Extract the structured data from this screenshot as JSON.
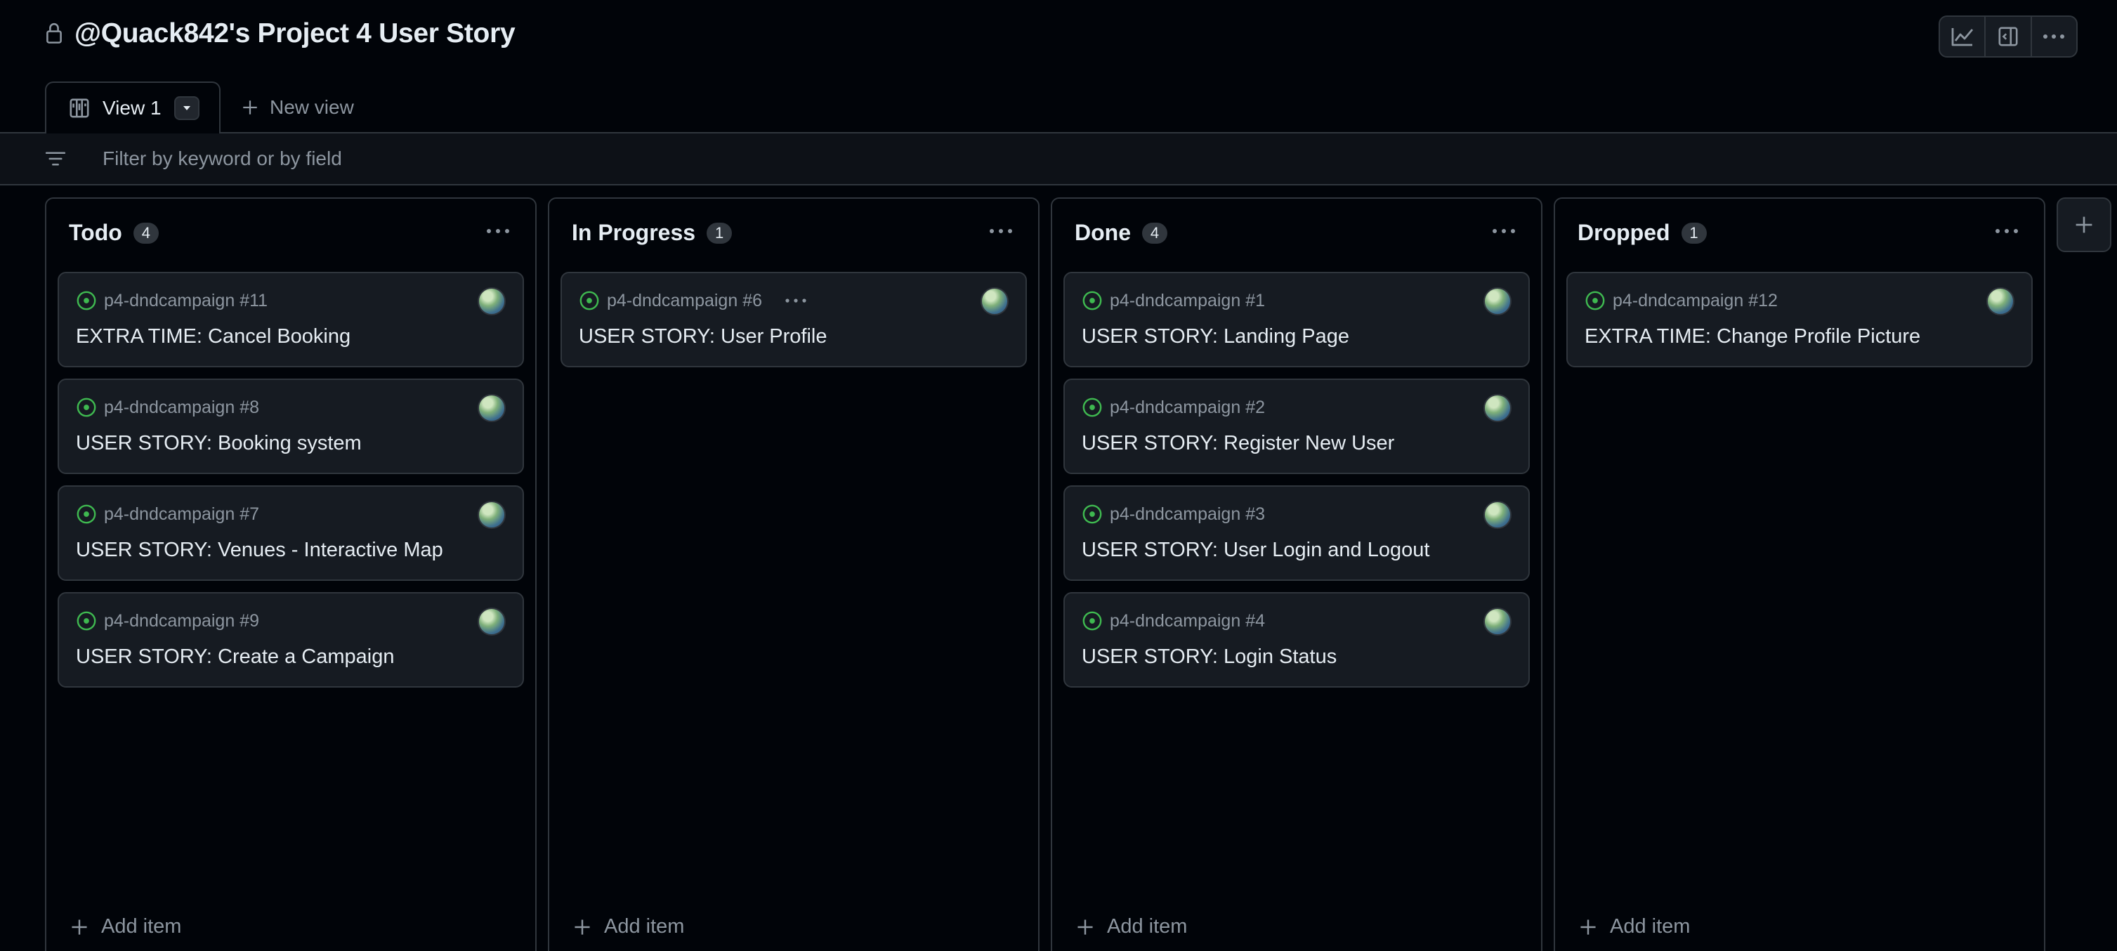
{
  "header": {
    "title": "@Quack842's Project 4 User Story",
    "actions": [
      "insights-icon",
      "side-panel-icon",
      "kebab-icon"
    ]
  },
  "tabs": {
    "active_label": "View 1",
    "new_view_label": "New view"
  },
  "filter": {
    "placeholder": "Filter by keyword or by field"
  },
  "columns": [
    {
      "title": "Todo",
      "count": "4",
      "add_label": "Add item",
      "cards": [
        {
          "repo": "p4-dndcampaign #11",
          "title": "EXTRA TIME: Cancel Booking"
        },
        {
          "repo": "p4-dndcampaign #8",
          "title": "USER STORY: Booking system"
        },
        {
          "repo": "p4-dndcampaign #7",
          "title": "USER STORY: Venues - Interactive Map"
        },
        {
          "repo": "p4-dndcampaign #9",
          "title": "USER STORY: Create a Campaign"
        }
      ]
    },
    {
      "title": "In Progress",
      "count": "1",
      "add_label": "Add item",
      "cards": [
        {
          "repo": "p4-dndcampaign #6",
          "title": "USER STORY: User Profile"
        }
      ]
    },
    {
      "title": "Done",
      "count": "4",
      "add_label": "Add item",
      "cards": [
        {
          "repo": "p4-dndcampaign #1",
          "title": "USER STORY: Landing Page"
        },
        {
          "repo": "p4-dndcampaign #2",
          "title": "USER STORY: Register New User"
        },
        {
          "repo": "p4-dndcampaign #3",
          "title": "USER STORY: User Login and Logout"
        },
        {
          "repo": "p4-dndcampaign #4",
          "title": "USER STORY: Login Status"
        }
      ]
    },
    {
      "title": "Dropped",
      "count": "1",
      "add_label": "Add item",
      "cards": [
        {
          "repo": "p4-dndcampaign #12",
          "title": "EXTRA TIME: Change Profile Picture"
        }
      ]
    }
  ],
  "colors": {
    "background": "#010409",
    "card": "#161b22",
    "border": "#30363d",
    "open_issue": "#3fb950",
    "muted_text": "#8d96a0"
  }
}
